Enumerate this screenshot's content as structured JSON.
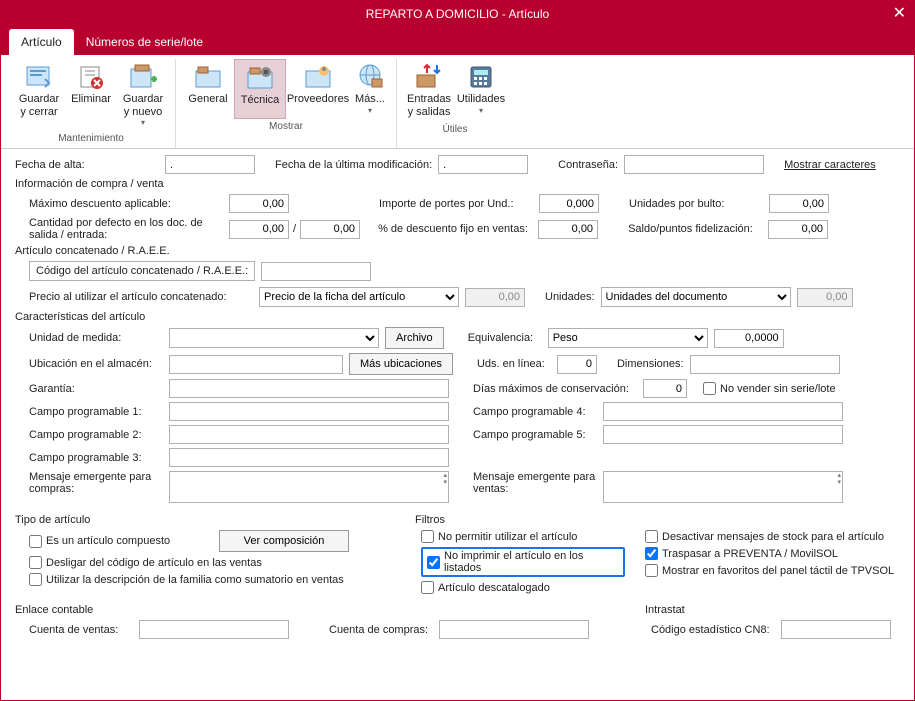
{
  "window": {
    "title": "REPARTO A DOMICILIO - Artículo"
  },
  "tabs": {
    "articulo": "Artículo",
    "series": "Números de serie/lote"
  },
  "ribbon": {
    "guardar_cerrar": "Guardar y cerrar",
    "eliminar": "Eliminar",
    "guardar_nuevo": "Guardar y nuevo",
    "general": "General",
    "tecnica": "Técnica",
    "proveedores": "Proveedores",
    "mas": "Más...",
    "entradas": "Entradas y salidas",
    "utilidades": "Utilidades",
    "grp_mant": "Mantenimiento",
    "grp_mostrar": "Mostrar",
    "grp_utiles": "Útiles"
  },
  "top": {
    "fecha_alta_lbl": "Fecha de alta:",
    "fecha_alta_val": ".",
    "fecha_mod_lbl": "Fecha de la última modificación:",
    "fecha_mod_val": ".",
    "contrasena_lbl": "Contraseña:",
    "mostrar_chars": "Mostrar caracteres"
  },
  "compra": {
    "section": "Información de compra / venta",
    "max_desc": "Máximo descuento aplicable:",
    "max_desc_val": "0,00",
    "cant_def": "Cantidad por defecto en los doc. de salida / entrada:",
    "cant_def_v1": "0,00",
    "cant_def_v2": "0,00",
    "imp_portes": "Importe de portes por Und.:",
    "imp_portes_val": "0,000",
    "pct_desc": "% de descuento fijo en ventas:",
    "pct_desc_val": "0,00",
    "und_bulto": "Unidades por bulto:",
    "und_bulto_val": "0,00",
    "saldo": "Saldo/puntos fidelización:",
    "saldo_val": "0,00"
  },
  "concat": {
    "section": "Artículo concatenado / R.A.E.E.",
    "cod_lbl": "Código del artículo concatenado / R.A.E.E.:",
    "precio_lbl": "Precio al utilizar el artículo concatenado:",
    "precio_opt": "Precio de la ficha del artículo",
    "precio_val": "0,00",
    "unidades_lbl": "Unidades:",
    "unidades_opt": "Unidades del documento",
    "unidades_val": "0,00"
  },
  "caract": {
    "section": "Características del artículo",
    "unidad_lbl": "Unidad de medida:",
    "archivo_btn": "Archivo",
    "equiv_lbl": "Equivalencia:",
    "equiv_opt": "Peso",
    "equiv_val": "0,0000",
    "ubic_lbl": "Ubicación en el almacén:",
    "mas_ubic_btn": "Más ubicaciones",
    "uds_linea_lbl": "Uds. en línea:",
    "uds_linea_val": "0",
    "dim_lbl": "Dimensiones:",
    "garantia_lbl": "Garantía:",
    "dias_cons_lbl": "Días máximos de conservación:",
    "dias_cons_val": "0",
    "no_vender_lbl": "No vender sin serie/lote",
    "campo1": "Campo programable 1:",
    "campo2": "Campo programable 2:",
    "campo3": "Campo programable 3:",
    "campo4": "Campo programable 4:",
    "campo5": "Campo programable 5:",
    "msg_compras_lbl": "Mensaje emergente para compras:",
    "msg_ventas_lbl": "Mensaje emergente para ventas:"
  },
  "tipo": {
    "section": "Tipo de artículo",
    "compuesto": "Es un artículo compuesto",
    "ver_comp_btn": "Ver composición",
    "desligar": "Desligar del código de artículo en las ventas",
    "usar_desc_fam": "Utilizar la descripción de la familia como sumatorio en ventas"
  },
  "filtros": {
    "section": "Filtros",
    "no_permitir": "No permitir utilizar el artículo",
    "no_imprimir": "No imprimir el artículo en los listados",
    "descatalogado": "Artículo descatalogado",
    "desactivar_stock": "Desactivar mensajes de stock para el artículo",
    "traspasar": "Traspasar a PREVENTA / MovilSOL",
    "mostrar_fav": "Mostrar en favoritos del panel táctil de TPVSOL"
  },
  "enlace": {
    "section": "Enlace contable",
    "cta_ventas": "Cuenta de ventas:",
    "cta_compras": "Cuenta de compras:"
  },
  "intrastat": {
    "section": "Intrastat",
    "cod_cn8": "Código estadístico CN8:"
  }
}
